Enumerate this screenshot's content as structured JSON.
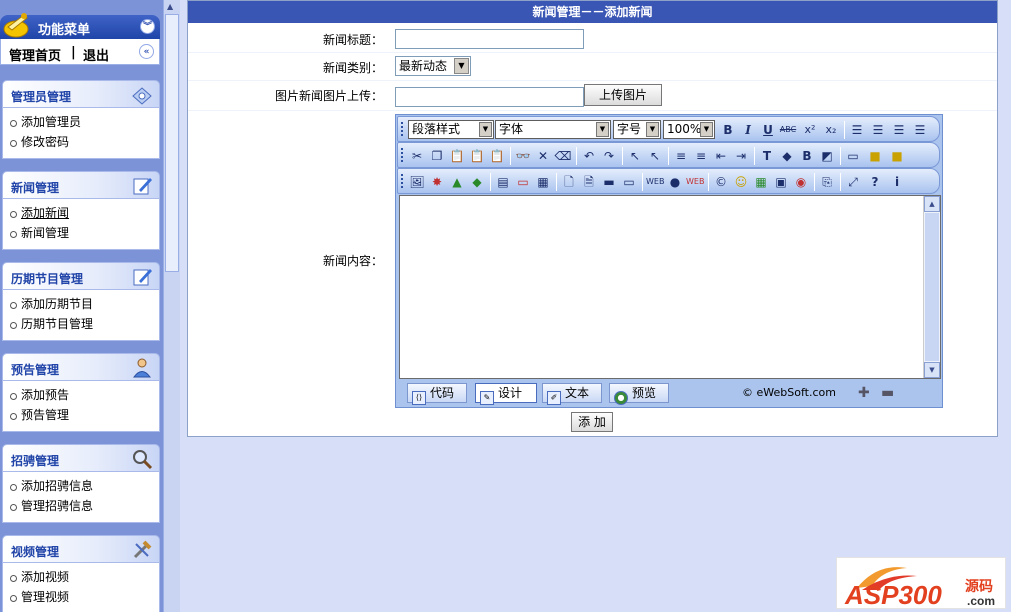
{
  "sidebar": {
    "menu_title": "功能菜单",
    "home_label": "管理首页",
    "separator": "|",
    "logout_label": "退出",
    "groups": [
      {
        "title": "管理员管理",
        "icon": "admin-icon",
        "items": [
          "添加管理员",
          "修改密码"
        ]
      },
      {
        "title": "新闻管理",
        "icon": "news-edit-icon",
        "items": [
          "添加新闻",
          "新闻管理"
        ]
      },
      {
        "title": "历期节目管理",
        "icon": "program-edit-icon",
        "items": [
          "添加历期节目",
          "历期节目管理"
        ]
      },
      {
        "title": "预告管理",
        "icon": "user-icon",
        "items": [
          "添加预告",
          "预告管理"
        ]
      },
      {
        "title": "招骋管理",
        "icon": "magnifier-icon",
        "items": [
          "添加招骋信息",
          "管理招骋信息"
        ]
      },
      {
        "title": "视频管理",
        "icon": "tools-icon",
        "items": [
          "添加视频",
          "管理视频"
        ]
      }
    ]
  },
  "main": {
    "title": "新闻管理－－添加新闻",
    "form": {
      "title_label": "新闻标题：",
      "title_value": "",
      "category_label": "新闻类别：",
      "category_value": "最新动态",
      "image_label": "图片新闻图片上传：",
      "image_value": "",
      "upload_button": "上传图片",
      "content_label": "新闻内容：",
      "submit_button": "添 加"
    },
    "editor": {
      "paragraph_style": "段落样式",
      "font": "字体",
      "font_size": "字号",
      "zoom": "100%",
      "modes": [
        "代码",
        "设计",
        "文本",
        "预览"
      ],
      "active_mode": "设计",
      "copyright": "© eWebSoft.com"
    }
  },
  "watermark": {
    "brand": "ASP300",
    "suffix": "源码",
    "domain": ".com"
  }
}
